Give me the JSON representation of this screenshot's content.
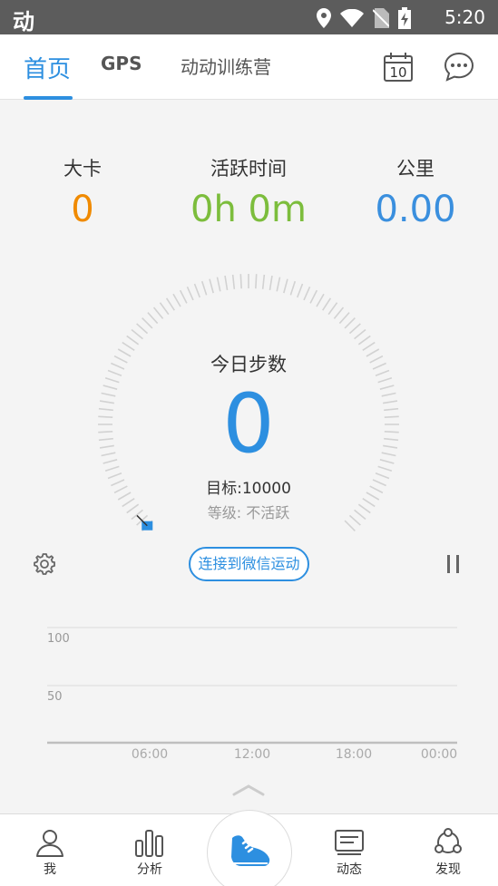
{
  "status_bar": {
    "app_glyph": "动",
    "time": "5:20"
  },
  "top_nav": {
    "tabs": [
      {
        "label": "首页",
        "active": true
      },
      {
        "label": "GPS",
        "active": false
      },
      {
        "label": "动动训练营",
        "active": false
      }
    ],
    "calendar_day": "10",
    "accent_color": "#2d8fe0"
  },
  "stats": [
    {
      "label": "大卡",
      "value": "0",
      "color": "#f08a00"
    },
    {
      "label": "活跃时间",
      "value": "0h 0m",
      "color": "#7cbd3c"
    },
    {
      "label": "公里",
      "value": "0.00",
      "color": "#3a8fde"
    }
  ],
  "dial": {
    "title": "今日步数",
    "steps": "0",
    "goal": "目标:10000",
    "level": "等级: 不活跃",
    "progress": 0
  },
  "actions": {
    "wechat_label": "连接到微信运动"
  },
  "chart_data": {
    "type": "bar",
    "y_ticks": [
      "100",
      "50"
    ],
    "x_ticks": [
      "06:00",
      "12:00",
      "18:00",
      "00:00"
    ],
    "values": []
  },
  "bottom_nav": {
    "items": [
      {
        "label": "我",
        "icon": "person-icon"
      },
      {
        "label": "分析",
        "icon": "bar-chart-icon"
      },
      {
        "label": "",
        "icon": "shoe-icon"
      },
      {
        "label": "动态",
        "icon": "feed-icon"
      },
      {
        "label": "发现",
        "icon": "discover-icon"
      }
    ]
  }
}
